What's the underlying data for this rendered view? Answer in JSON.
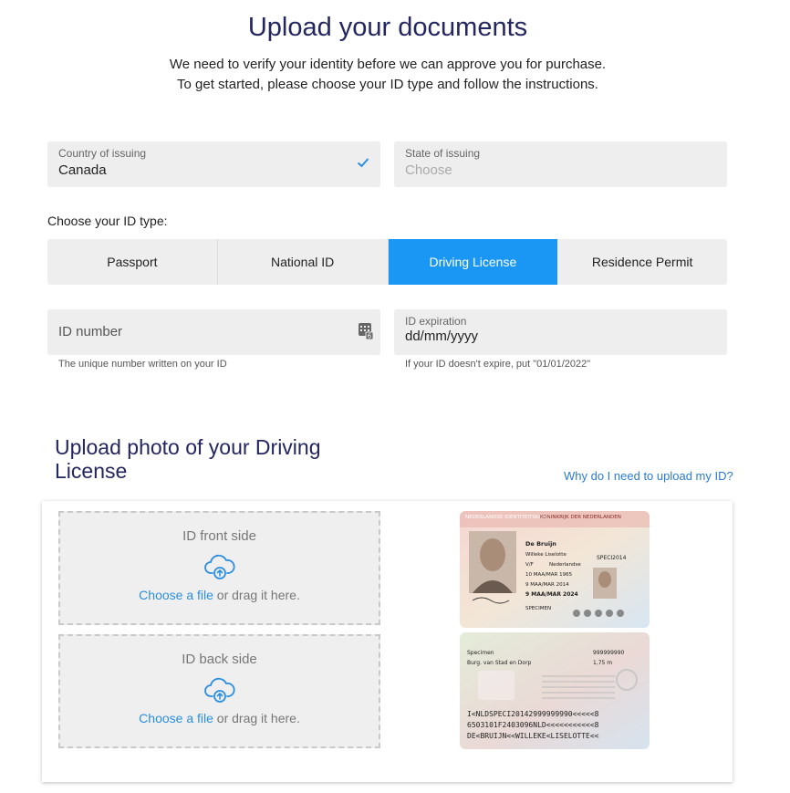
{
  "header": {
    "title": "Upload your documents",
    "intro_line1": "We need to verify your identity before we can approve you for purchase.",
    "intro_line2": "To get started, please choose your ID type and follow the instructions."
  },
  "country": {
    "label": "Country of issuing",
    "value": "Canada"
  },
  "state": {
    "label": "State of issuing",
    "placeholder": "Choose"
  },
  "id_type": {
    "label": "Choose your ID type:",
    "options": [
      "Passport",
      "National ID",
      "Driving License",
      "Residence Permit"
    ],
    "selected": "Driving License"
  },
  "id_number": {
    "placeholder": "ID number",
    "hint": "The unique number written on your ID"
  },
  "id_expiration": {
    "label": "ID expiration",
    "placeholder": "dd/mm/yyyy",
    "hint": "If your ID doesn't expire, put \"01/01/2022\""
  },
  "upload": {
    "title": "Upload photo of your Driving License",
    "why_link": "Why do I need to upload my ID?",
    "front": {
      "title": "ID front side",
      "link": "Choose a file",
      "suffix": " or drag it here."
    },
    "back": {
      "title": "ID back side",
      "link": "Choose a file",
      "suffix": " or drag it here."
    }
  },
  "sample_card": {
    "front_header_left": "NEDERLANDSE IDENTITEITSKAART",
    "front_header_right": "KONINKRIJK DER NEDERLANDEN",
    "surname": "De Bruijn",
    "given_names": "Willeke Liselotte",
    "sex": "V/F",
    "nationality": "Nederlandse",
    "birth_date": "10 MAA/MAR 1965",
    "doc_number": "SPECI2014",
    "issue_date": "9 MAA/MAR 2014",
    "expiry_date": "9 MAA/MAR 2024",
    "specimen": "SPECIMEN",
    "back_surname": "Specimen",
    "back_place": "Burg. van Stad en Dorp",
    "back_number": "999999990",
    "back_height": "1,75 m",
    "mrz1": "I<NLDSPECI20142999999990<<<<<8",
    "mrz2": "6503101F2403096NLD<<<<<<<<<<<8",
    "mrz3": "DE<BRUIJN<<WILLEKE<LISELOTTE<<"
  },
  "colors": {
    "accent": "#1a96f5",
    "title": "#23265f",
    "link": "#2b8fe0",
    "field_bg": "#eeeeee"
  }
}
